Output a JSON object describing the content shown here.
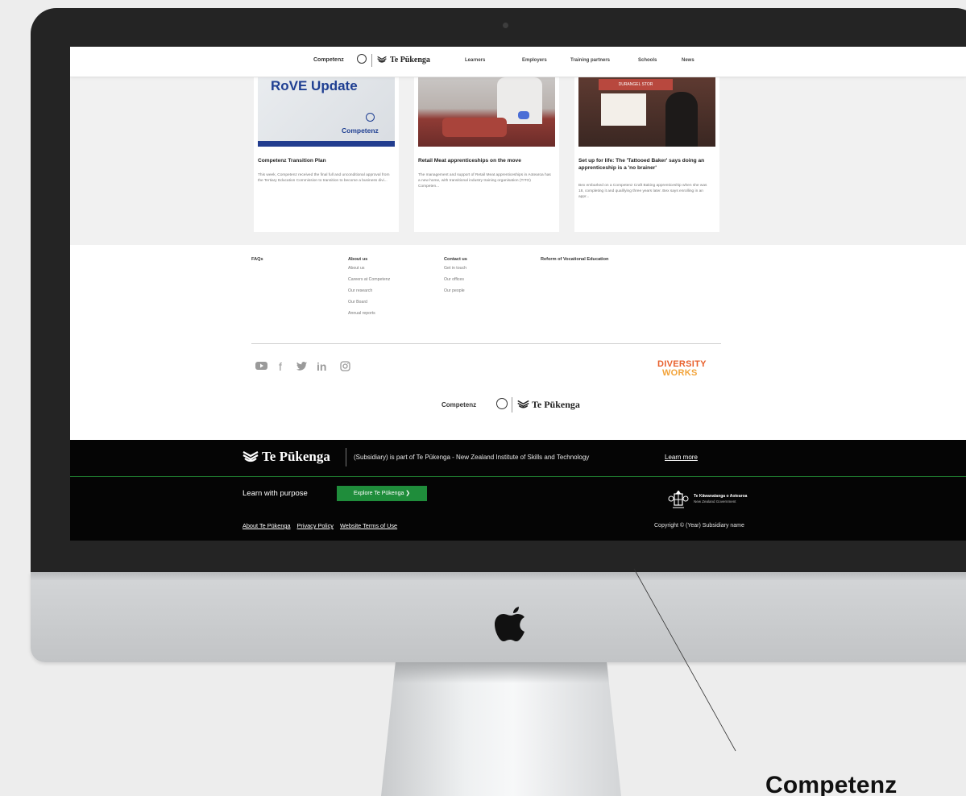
{
  "header": {
    "brand": "Competenz",
    "te_pukenga": "Te Pūkenga",
    "nav": [
      "Learners",
      "Employers",
      "Training partners",
      "Schools",
      "News"
    ]
  },
  "cards": [
    {
      "image_title": "RoVE Update",
      "image_brand": "Competenz",
      "title": "Competenz Transition Plan",
      "text": "This week, Competenz received the final full and unconditional approval from the Tertiary Education Commission to transition to become a business divi..."
    },
    {
      "title": "Retail Meat apprenticeships on the move",
      "text": "The management and support of Retail Meat apprenticeships in Aotearoa has a new home, with transitional industry training organisation (TITO) Competen..."
    },
    {
      "image_sign": "DURANGEL STOR",
      "title": "Set up for life: The 'Tattooed Baker' says doing an apprenticeship is a 'no brainer'",
      "text": "Bex embarked on a Competenz Craft Baking apprenticeship when she was 18, completing it and qualifying three years later. Bex says enrolling in an appr..."
    }
  ],
  "footer": {
    "columns": [
      {
        "heading": "FAQs",
        "links": []
      },
      {
        "heading": "About us",
        "links": [
          "About us",
          "Careers at Competenz",
          "Our research",
          "Our Board",
          "Annual reports"
        ]
      },
      {
        "heading": "Contact us",
        "links": [
          "Get in touch",
          "Our offices",
          "Our people"
        ]
      },
      {
        "heading": "Reform of Vocational Education",
        "links": []
      }
    ],
    "social_icons": [
      "youtube-icon",
      "facebook-icon",
      "twitter-icon",
      "linkedin-icon",
      "instagram-icon"
    ],
    "diversity_top": "DIVERSITY",
    "diversity_bottom": "WORKS",
    "brand": "Competenz",
    "te_pukenga": "Te Pūkenga"
  },
  "black_bar": {
    "wordmark": "Te Pūkenga",
    "subtitle": "(Subsidiary) is part of Te Pūkenga - New Zealand Institute of Skills and Technology",
    "learn_more": "Learn more",
    "learn_with_purpose": "Learn with purpose",
    "explore_button": "Explore Te Pūkenga ❯",
    "links": [
      "About Te Pūkenga",
      "Privacy Policy",
      "Website Terms of Use"
    ],
    "gov_name": "Te Kāwanatanga o Aotearoa",
    "gov_sub": "New Zealand Government",
    "copyright": "Copyright © (Year) Subsidiary name"
  },
  "caption": "Competenz",
  "colors": {
    "accent_green": "#1f8d3b",
    "rove_blue": "#1f3f92",
    "diversity_orange": "#e8602c"
  }
}
